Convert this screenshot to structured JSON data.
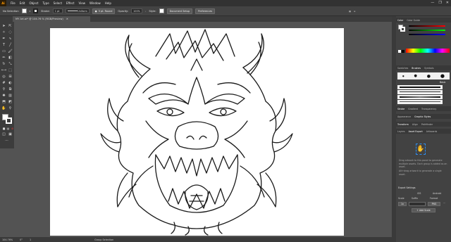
{
  "app": {
    "logo": "Ai"
  },
  "menu": [
    "File",
    "Edit",
    "Object",
    "Type",
    "Select",
    "Effect",
    "View",
    "Window",
    "Help"
  ],
  "window_controls": [
    "—",
    "❐",
    "✕"
  ],
  "control_bar": {
    "selection": "No Selection",
    "stroke_label": "Stroke:",
    "stroke_value": "1 pt",
    "stroke_line": "Uniform",
    "brush": "5 pt. Round",
    "opacity_label": "Opacity:",
    "opacity_value": "100%",
    "style_label": "Style:",
    "document_setup": "Document Setup",
    "preferences": "Preferences"
  },
  "document": {
    "tab_label": "MY Art.ai* @ 104.76 % (RGB/Preview)",
    "close": "✕"
  },
  "status": {
    "zoom": "104.76%",
    "rotation": "0°",
    "page": "1",
    "mode": "Group Selection"
  },
  "right_panel": {
    "color_tabs": [
      "Color",
      "Color Guide"
    ],
    "swatch_tabs": [
      "Swatches",
      "Brushes",
      "Symbols"
    ],
    "basic_label": "Basic",
    "stroke_tabs": [
      "Stroke",
      "Gradient",
      "Transparency"
    ],
    "appearance_tabs": [
      "Appearance",
      "Graphic Styles"
    ],
    "transform_tabs": [
      "Transform",
      "Align",
      "Pathfinder"
    ],
    "export_tabs": [
      "Layers",
      "Asset Export",
      "Artboards"
    ],
    "export_hint1": "Drag artwork to this panel to generate multiple assets. Each group is added as an asset.",
    "export_hint2": "Alt+drag artwork to generate a single asset.",
    "export_settings": "Export Settings",
    "scale_label": "Scale",
    "suffix_label": "Suffix",
    "format_label": "Format",
    "scale_value": "1x",
    "format_value": "PNG",
    "add_scale": "+ Add Scale",
    "ios_label": "iOS",
    "android_label": "Android"
  },
  "colors": {
    "accent": "#2d8ceb",
    "artboard": "#ffffff",
    "pasteboard": "#535353",
    "line": "#1a1a1a"
  }
}
